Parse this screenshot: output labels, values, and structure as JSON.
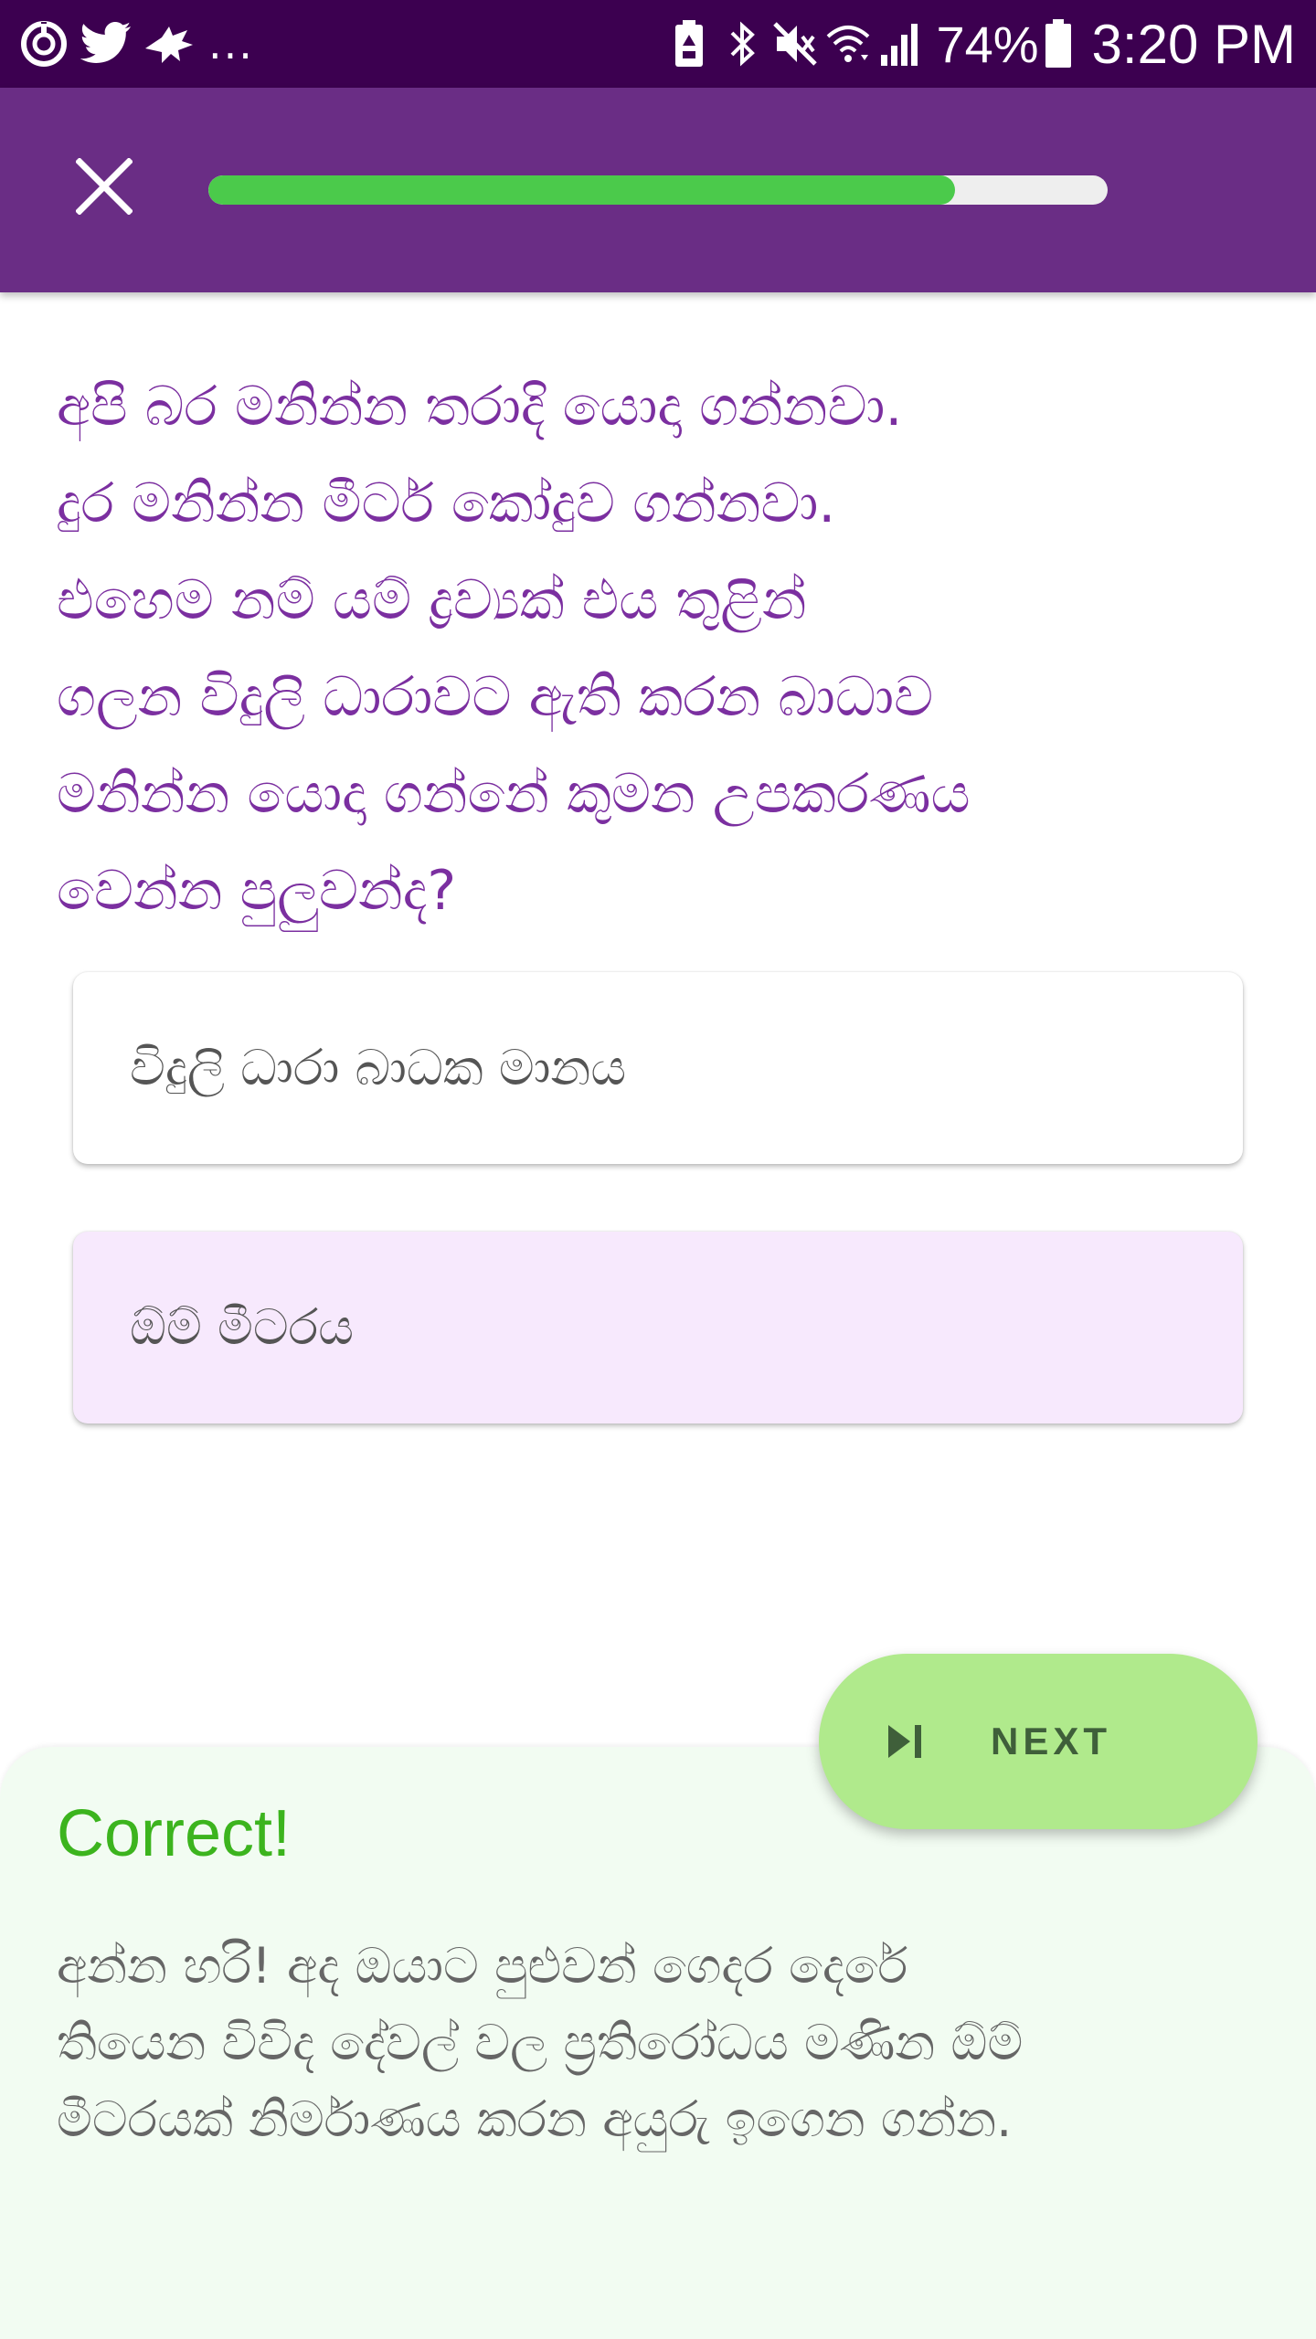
{
  "status_bar": {
    "left_icons": [
      "sync-icon",
      "twitter-icon",
      "bird-icon"
    ],
    "more": "...",
    "right_icons": [
      "battery-saver-icon",
      "bluetooth-icon",
      "mute-icon",
      "wifi-icon",
      "signal-icon",
      "battery-icon"
    ],
    "battery": "74%",
    "time": "3:20 PM"
  },
  "header": {
    "close_icon": "close-icon",
    "progress_fraction": 0.83,
    "colors": {
      "bar": "#6a2d85",
      "progress_fill": "#4bca4b",
      "progress_track": "#eeeeee"
    }
  },
  "question": {
    "text": "අපි බර මනින්න තරාදි යොදා ගන්නවා.\nදුර මනින්න මීටර් කෝදුව ගන්නවා.\nඑහෙම නම් යම් ද්‍රව්‍යක් එය තුළින්\nගලන විදුලි ධාරාවට ඇති කරන බාධාව\nමනින්න යොදා ගන්නේ කුමන උපකරණය\nවෙන්න පුලුවන්ද?"
  },
  "options": [
    {
      "label": "විදුලි ධාරා බාධක මානය",
      "selected": false
    },
    {
      "label": "ඕම් මීටරය",
      "selected": true
    }
  ],
  "feedback": {
    "title": "Correct!",
    "text": "අන්න හරි! අද ඔයාට පුළුවන් ගෙදර දෙරේ\nතියෙන විවිද දේවල් වල ප්‍රතිරෝධය මණින ඕම්\nමීටරයක් නිර්මාණය කරන අයුරු ඉගෙන ගන්න.",
    "colors": {
      "title": "#3cb41e",
      "background": "#f2fcf2"
    }
  },
  "next_button": {
    "label": "NEXT",
    "icon": "skip-next-icon",
    "color": "#b0ea8c"
  }
}
